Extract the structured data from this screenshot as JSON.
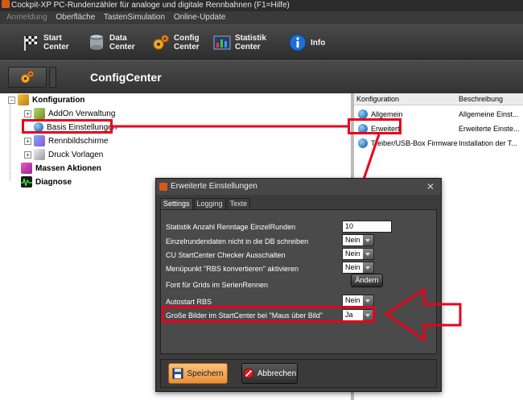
{
  "window": {
    "title": "Cockpit-XP PC-Rundenzähler für analoge und digitale Rennbahnen (F1=Hilfe)"
  },
  "menu": {
    "items": [
      {
        "label": "Anmeldung",
        "disabled": true
      },
      {
        "label": "Oberfläche",
        "disabled": false
      },
      {
        "label": "TastenSimulation",
        "disabled": false
      },
      {
        "label": "Online-Update",
        "disabled": false
      }
    ]
  },
  "toolbar": {
    "start": {
      "line1": "Start",
      "line2": "Center"
    },
    "data": {
      "line1": "Data",
      "line2": "Center"
    },
    "config": {
      "line1": "Config",
      "line2": "Center"
    },
    "statistik": {
      "line1": "Statistik",
      "line2": "Center"
    },
    "info": {
      "label": "Info"
    }
  },
  "subheader": {
    "title": "ConfigCenter"
  },
  "tree": {
    "root": "Konfiguration",
    "children": [
      "AddOn Verwaltung",
      "Basis Einstellungen",
      "Rennbildschirme",
      "Druck Vorlagen"
    ],
    "massen": "Massen Aktionen",
    "diagnose": "Diagnose"
  },
  "rlist": {
    "headers": [
      "Konfiguration",
      "Beschreibung"
    ],
    "rows": [
      {
        "name": "Allgemein",
        "desc": "Allgemeine Einst..."
      },
      {
        "name": "Erweitert",
        "desc": "Erweiterte Einste..."
      },
      {
        "name": "Treiber/USB-Box Firmware",
        "desc": "Installation der T..."
      }
    ]
  },
  "dialog": {
    "title": "Erweiterte Einstellungen",
    "close": "✕",
    "tabs": [
      "Settings",
      "Logging",
      "Texte"
    ],
    "fields": {
      "statistik_label": "Statistik Anzahl Renntage EinzelRunden",
      "statistik_value": "10",
      "einzel_label": "Einzelrundendaten nicht in die DB schreiben",
      "einzel_value": "Nein",
      "cu_label": "CU StartCenter Checker Ausschalten",
      "cu_value": "Nein",
      "menu_label": "Menüpunkt \"RBS konvertieren\" aktivieren",
      "menu_value": "Nein",
      "font_label": "Font für Grids im SerienRennen",
      "font_button": "Ändern",
      "autostart_label": "Autostart RBS",
      "autostart_value": "Nein",
      "bilder_label": "Große Bilder im StartCenter bei \"Maus über Bild\"",
      "bilder_value": "Ja"
    },
    "buttons": {
      "save": "Speichern",
      "cancel": "Abbrechen"
    }
  },
  "colors": {
    "annotation_red": "#e8001c",
    "save_orange": "#e8903a"
  }
}
